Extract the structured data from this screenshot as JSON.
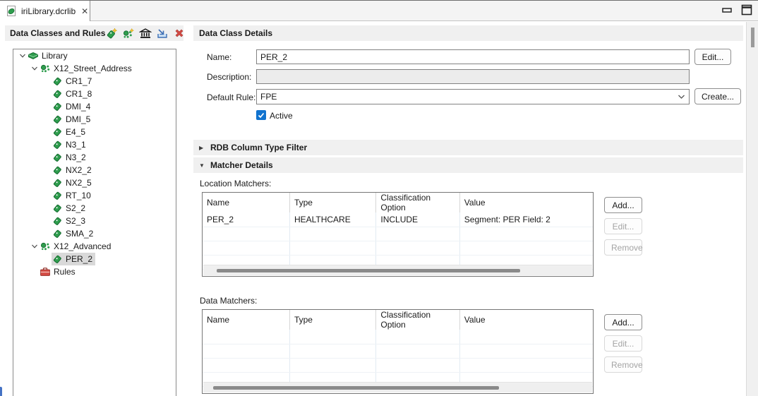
{
  "tab": {
    "title": "iriLibrary.dcrlib",
    "close_icon": "close-icon",
    "file_icon": "dcrlib-file-icon"
  },
  "window_controls": {
    "icons": [
      "minimize-icon",
      "maximize-icon"
    ]
  },
  "left_panel": {
    "title": "Data Classes and Rules",
    "toolbar_icons": [
      "new-data-class-icon",
      "new-data-class-group-icon",
      "bank-import-icon",
      "import-icon",
      "delete-icon"
    ],
    "tree": [
      {
        "label": "Library",
        "level": 0,
        "icon": "library",
        "expander": true
      },
      {
        "label": "X12_Street_Address",
        "level": 1,
        "icon": "group",
        "expander": true
      },
      {
        "label": "CR1_7",
        "level": 2,
        "icon": "tag"
      },
      {
        "label": "CR1_8",
        "level": 2,
        "icon": "tag"
      },
      {
        "label": "DMI_4",
        "level": 2,
        "icon": "tag"
      },
      {
        "label": "DMI_5",
        "level": 2,
        "icon": "tag"
      },
      {
        "label": "E4_5",
        "level": 2,
        "icon": "tag"
      },
      {
        "label": "N3_1",
        "level": 2,
        "icon": "tag"
      },
      {
        "label": "N3_2",
        "level": 2,
        "icon": "tag"
      },
      {
        "label": "NX2_2",
        "level": 2,
        "icon": "tag"
      },
      {
        "label": "NX2_5",
        "level": 2,
        "icon": "tag"
      },
      {
        "label": "RT_10",
        "level": 2,
        "icon": "tag"
      },
      {
        "label": "S2_2",
        "level": 2,
        "icon": "tag"
      },
      {
        "label": "S2_3",
        "level": 2,
        "icon": "tag"
      },
      {
        "label": "SMA_2",
        "level": 2,
        "icon": "tag"
      },
      {
        "label": "X12_Advanced",
        "level": 1,
        "icon": "group",
        "expander": true
      },
      {
        "label": "PER_2",
        "level": 2,
        "icon": "tag",
        "selected": true
      },
      {
        "label": "Rules",
        "level": 1,
        "icon": "rules"
      }
    ]
  },
  "details": {
    "title": "Data Class Details",
    "name_label": "Name:",
    "name_value": "PER_2",
    "edit_button": "Edit...",
    "description_label": "Description:",
    "description_value": "",
    "default_rule_label": "Default Rule:",
    "default_rule_value": "FPE",
    "create_button": "Create...",
    "active_label": "Active",
    "active_checked": true,
    "sections": {
      "rdb": {
        "label": "RDB Column Type Filter",
        "expanded": false
      },
      "matcher": {
        "label": "Matcher Details",
        "expanded": true
      }
    },
    "location_matchers": {
      "label": "Location Matchers:",
      "columns": [
        "Name",
        "Type",
        "Classification Option",
        "Value"
      ],
      "rows": [
        [
          "PER_2",
          "HEALTHCARE",
          "INCLUDE",
          "Segment: PER Field: 2"
        ]
      ],
      "buttons": [
        {
          "label": "Add...",
          "enabled": true
        },
        {
          "label": "Edit...",
          "enabled": false
        },
        {
          "label": "Remove",
          "enabled": false
        }
      ]
    },
    "data_matchers": {
      "label": "Data Matchers:",
      "columns": [
        "Name",
        "Type",
        "Classification Option",
        "Value"
      ],
      "rows": [],
      "buttons": [
        {
          "label": "Add...",
          "enabled": true
        },
        {
          "label": "Edit...",
          "enabled": false
        },
        {
          "label": "Remove",
          "enabled": false
        }
      ]
    }
  },
  "colors": {
    "header_bar": "#f0f0f0",
    "accent_checkbox": "#1173cf",
    "tag_green": "#1e9e46",
    "rules_red": "#cc3333",
    "selection_gray": "#d9d9d9",
    "delete_red": "#d24a43"
  }
}
